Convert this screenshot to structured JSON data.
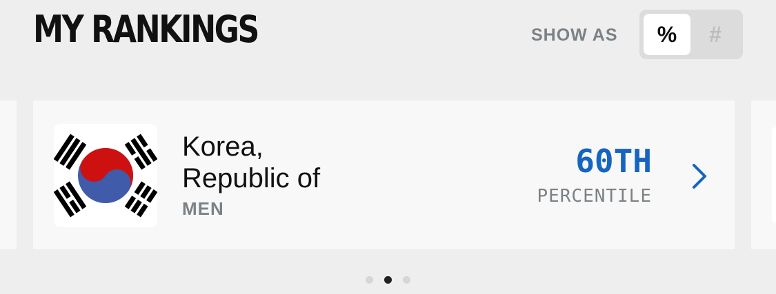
{
  "header": {
    "title": "MY RANKINGS",
    "show_as_label": "SHOW AS",
    "toggle": {
      "options": [
        "%",
        "#"
      ],
      "selected": "%"
    }
  },
  "card": {
    "flag_icon": "south-korea-flag-icon",
    "country_line1": "Korea,",
    "country_line2": "Republic of",
    "gender": "MEN",
    "rank": "60TH",
    "rank_unit": "PERCENTILE",
    "rank_color": "#1565c0",
    "chevron_icon": "chevron-right-icon"
  },
  "pagination": {
    "count": 3,
    "active_index": 1
  }
}
